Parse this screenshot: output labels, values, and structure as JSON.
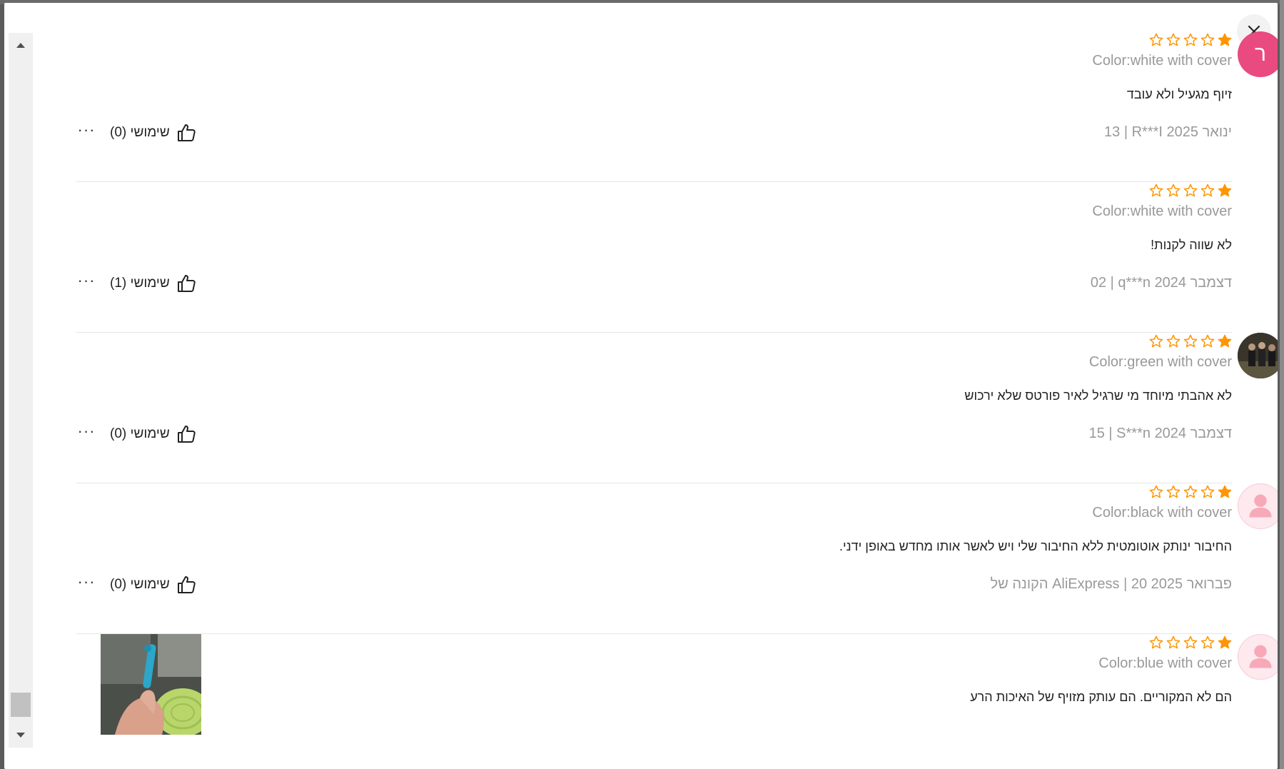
{
  "window": {
    "close_label": "close"
  },
  "colors": {
    "star": "#ff9500",
    "avatar_pink": "#e94a7f",
    "muted_text": "#999999"
  },
  "reviews": [
    {
      "avatar_letter": "ר",
      "rating": 1,
      "color": "Color:white with cover",
      "text": "זיוף מגעיל ולא עובד",
      "meta": "13 | R***I ינואר 2025",
      "helpful": "שימושי (0)"
    },
    {
      "avatar_letter": "",
      "rating": 1,
      "color": "Color:white with cover",
      "text": "לא שווה לקנות!",
      "meta": "02 | q***n דצמבר 2024",
      "helpful": "שימושי (1)"
    },
    {
      "avatar_letter": "",
      "rating": 1,
      "color": "Color:green with cover",
      "text": "לא אהבתי מיוחד מי שרגיל לאיר פורטס שלא ירכוש",
      "meta": "15 | S***n דצמבר 2024",
      "helpful": "שימושי (0)"
    },
    {
      "avatar_letter": "",
      "rating": 1,
      "color": "Color:black with cover",
      "text": "החיבור ינותק אוטומטית ללא החיבור שלי ויש לאשר אותו מחדש באופן ידני.",
      "meta": "הקונה של AliExpress | 20 פברואר 2025",
      "helpful": "שימושי (0)"
    },
    {
      "avatar_letter": "",
      "rating": 1,
      "color": "Color:blue with cover",
      "text": "הם לא המקוריים. הם עותק מזויף של האיכות הרע",
      "meta": "",
      "helpful": ""
    }
  ],
  "more_label": "···"
}
